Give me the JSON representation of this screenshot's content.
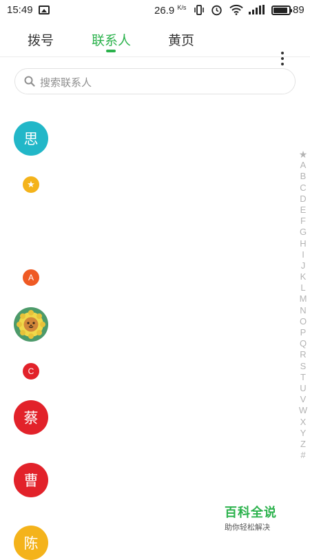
{
  "status_bar": {
    "time": "15:49",
    "net_speed": "26.9",
    "net_speed_unit": "K/s",
    "battery_level": "89"
  },
  "tabs": [
    {
      "label": "拨号",
      "active": false
    },
    {
      "label": "联系人",
      "active": true
    },
    {
      "label": "黄页",
      "active": false
    }
  ],
  "search": {
    "placeholder": "搜索联系人"
  },
  "contacts": [
    {
      "type": "avatar",
      "text": "思",
      "color": "#22b7c8"
    },
    {
      "type": "section",
      "text": "★",
      "color": "#f4b31b"
    },
    {
      "type": "section",
      "text": "A",
      "color": "#ef5a24"
    },
    {
      "type": "avatar-image",
      "icon": "lion-avatar",
      "color": "#4c9a6a"
    },
    {
      "type": "section",
      "text": "C",
      "color": "#e2222a"
    },
    {
      "type": "avatar",
      "text": "蔡",
      "color": "#e2222a"
    },
    {
      "type": "avatar",
      "text": "曹",
      "color": "#e2222a"
    },
    {
      "type": "avatar",
      "text": "陈",
      "color": "#f4b31b"
    }
  ],
  "alphabet_index": [
    "★",
    "A",
    "B",
    "C",
    "D",
    "E",
    "F",
    "G",
    "H",
    "I",
    "J",
    "K",
    "L",
    "M",
    "N",
    "O",
    "P",
    "Q",
    "R",
    "S",
    "T",
    "U",
    "V",
    "W",
    "X",
    "Y",
    "Z",
    "#"
  ],
  "watermark": {
    "title": "百科全说",
    "subtitle": "助你轻松解决"
  },
  "colors": {
    "accent": "#2bb24c"
  }
}
